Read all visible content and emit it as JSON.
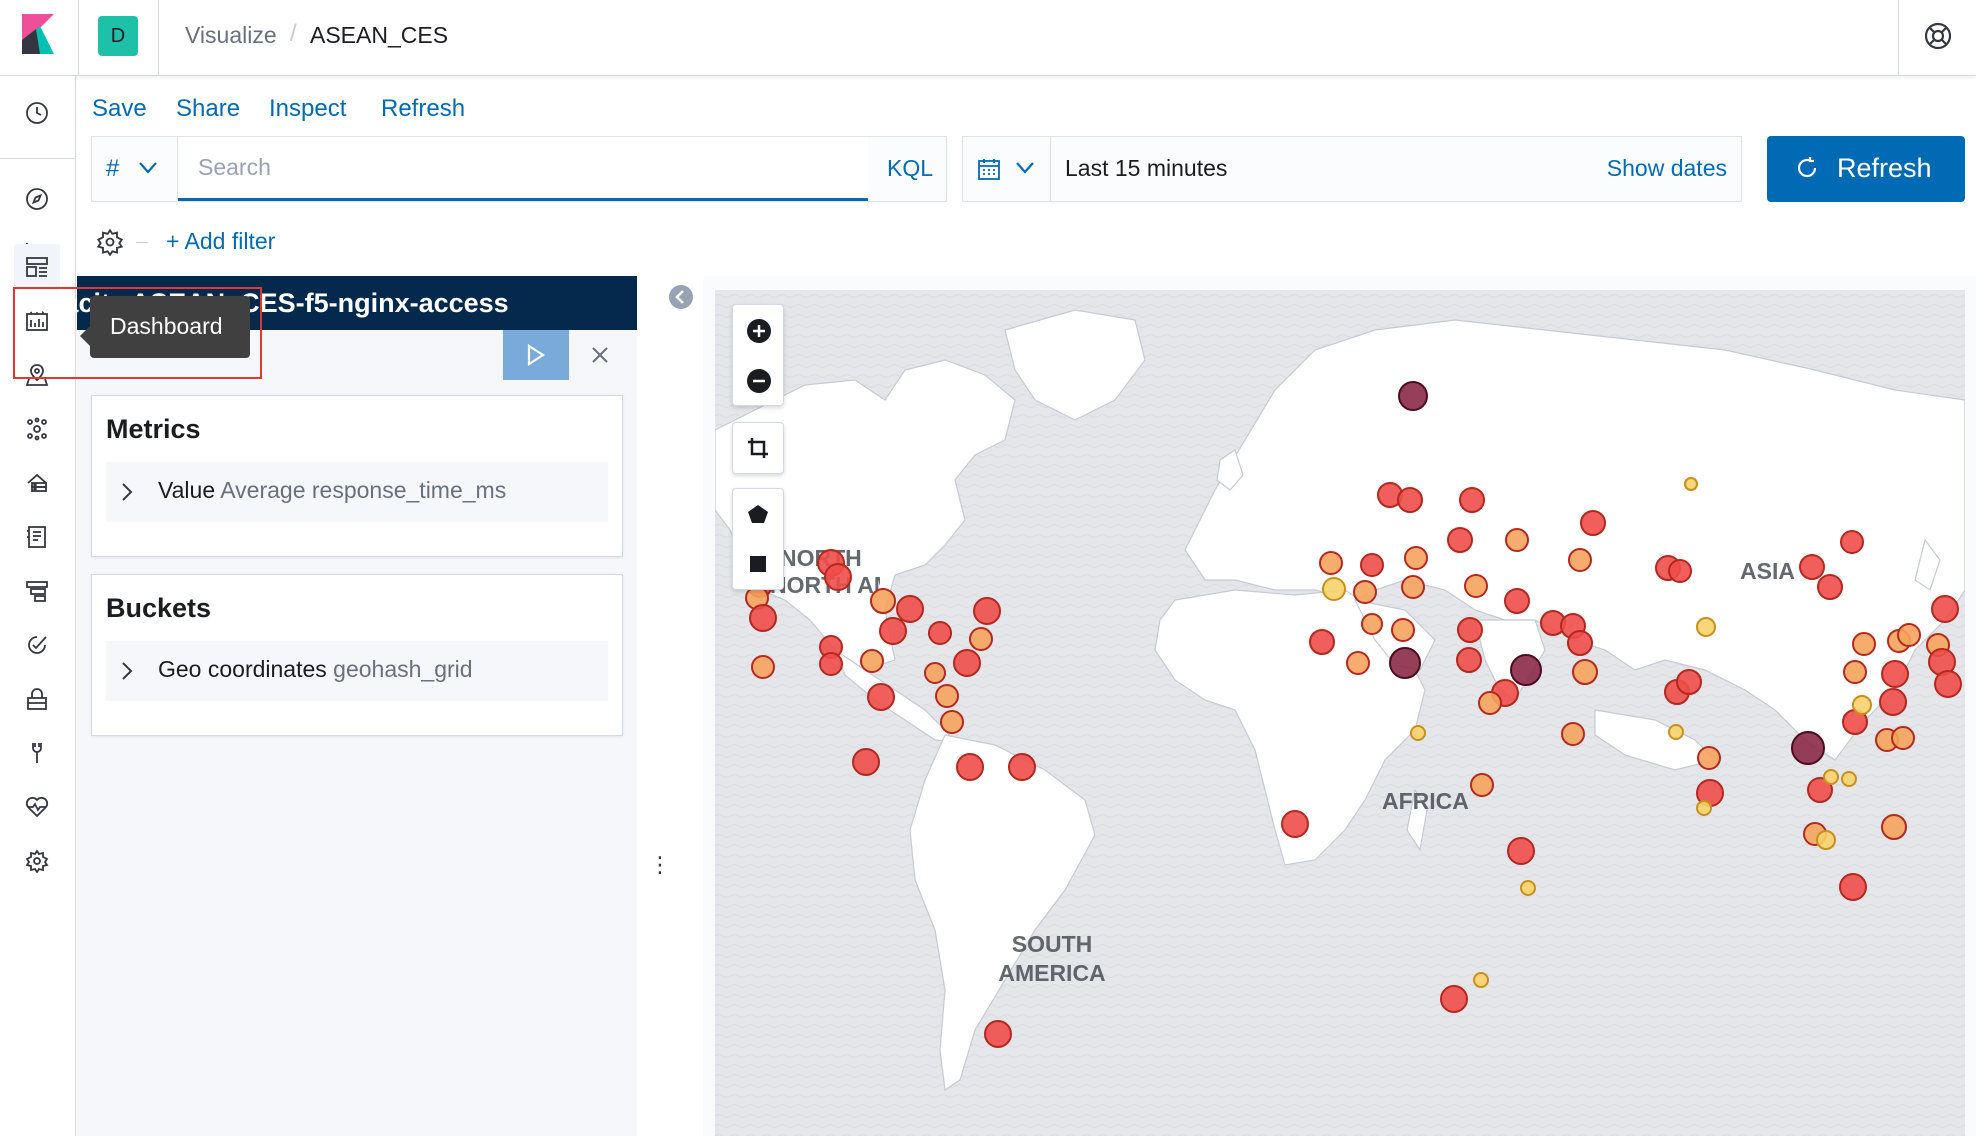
{
  "header": {
    "space_initial": "D",
    "breadcrumbs": [
      "Visualize",
      "ASEAN_CES"
    ],
    "breadcrumb_separator": "/"
  },
  "nav": {
    "items": [
      "clock-icon",
      "compass-icon",
      "visualize-icon",
      "dashboard-icon",
      "canvas-icon",
      "maps-icon",
      "ml-icon",
      "infrastructure-icon",
      "logs-icon",
      "apm-icon",
      "uptime-icon",
      "siem-icon",
      "devtools-icon",
      "monitoring-icon",
      "management-icon"
    ],
    "active": "dashboard-icon",
    "tooltip": "Dashboard"
  },
  "toolbar": {
    "links": [
      "Save",
      "Share",
      "Inspect",
      "Refresh"
    ]
  },
  "query": {
    "language_symbol": "#",
    "placeholder": "Search",
    "value": "",
    "language": "KQL"
  },
  "time": {
    "range": "Last 15 minutes",
    "show_dates": "Show dates",
    "refresh": "Refresh"
  },
  "filters": {
    "add_filter": "+ Add filter"
  },
  "editor": {
    "index_pattern": "kapacity.ASEAN_CES-f5-nginx-access",
    "visible_index_text": "f5-nginx-access",
    "metrics": {
      "title": "Metrics",
      "row_label": "Value",
      "row_value": "Average response_time_ms"
    },
    "buckets": {
      "title": "Buckets",
      "row_label": "Geo coordinates",
      "row_value": "geohash_grid"
    }
  },
  "map": {
    "labels": [
      "NORTH AMERICA",
      "ASIA",
      "AFRICA",
      "SOUTH AMERICA"
    ],
    "colors": {
      "low": "#f7d26c",
      "mid": "#f5a35c",
      "high": "#ee4e49",
      "max": "#8b2a48",
      "land": "#ffffff",
      "water": "#e6e8ec"
    }
  },
  "colors": {
    "accent": "#006bb4",
    "index_bar": "#04294c",
    "space_badge": "#1fc0a8",
    "highlight": "#e03a2f"
  }
}
